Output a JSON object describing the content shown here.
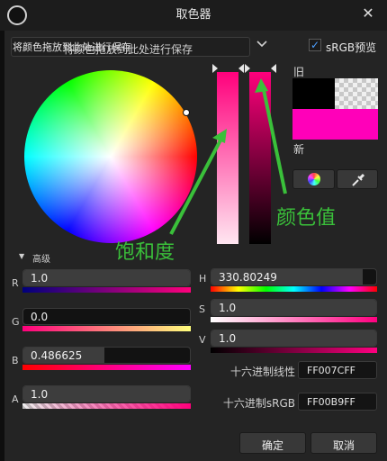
{
  "window": {
    "title": "取色器"
  },
  "toolbar": {
    "save_text_overlay": "将颜色拖放到此处进行保存",
    "save_placeholder": "将颜色拖放到此处进行保存",
    "srgb_preview_label": "sRGB预览",
    "srgb_preview_checked": true
  },
  "preview": {
    "old_label": "旧",
    "new_label": "新",
    "old_color": "#000000",
    "new_color": "#FF00B9"
  },
  "annotations": {
    "saturation": "饱和度",
    "value": "颜色值"
  },
  "advanced": {
    "label": "高级",
    "expanded": true
  },
  "rgb": {
    "r": {
      "label": "R",
      "value": "1.0",
      "fill": 1.0
    },
    "g": {
      "label": "G",
      "value": "0.0",
      "fill": 0.0
    },
    "b": {
      "label": "B",
      "value": "0.486625",
      "fill": 0.486625
    },
    "a": {
      "label": "A",
      "value": "1.0",
      "fill": 1.0
    }
  },
  "hsv": {
    "h": {
      "label": "H",
      "value": "330.80249",
      "fill": 0.92
    },
    "s": {
      "label": "S",
      "value": "1.0",
      "fill": 1.0
    },
    "v": {
      "label": "V",
      "value": "1.0",
      "fill": 1.0
    }
  },
  "hex": {
    "linear_label": "十六进制线性",
    "linear_value": "FF007CFF",
    "srgb_label": "十六进制sRGB",
    "srgb_value": "FF00B9FF"
  },
  "buttons": {
    "ok": "确定",
    "cancel": "取消"
  },
  "icons": {
    "logo": "unreal-logo-icon",
    "close": "close-icon",
    "chevron": "chevron-down-icon",
    "wheel": "color-wheel-icon",
    "picker": "eyedropper-icon"
  }
}
